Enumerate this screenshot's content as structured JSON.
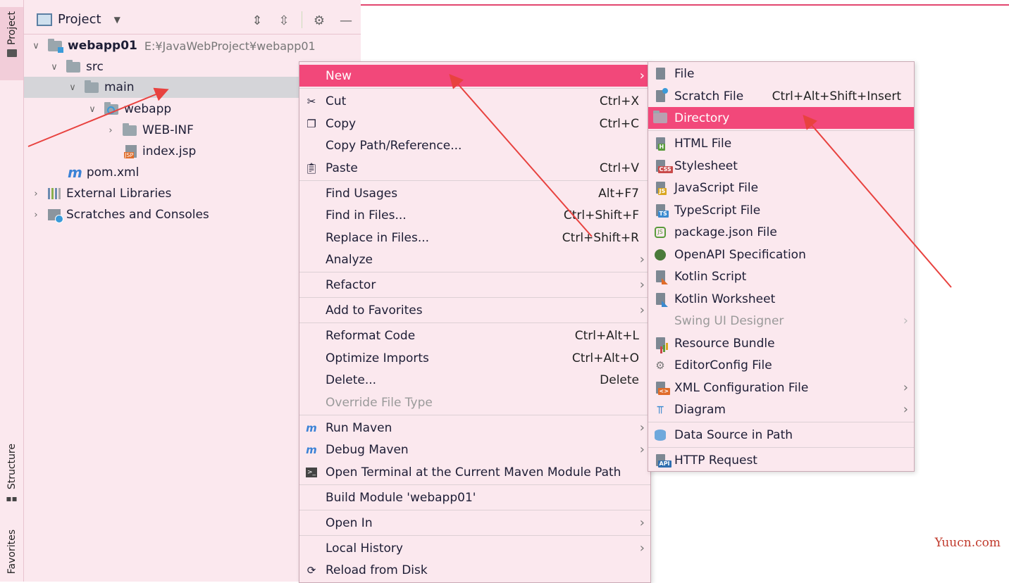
{
  "tool_strip": {
    "project_tab": "Project",
    "structure_tab": "Structure",
    "favorites_tab": "Favorites"
  },
  "panel": {
    "title": "Project",
    "tree": [
      {
        "label": "webapp01",
        "path": "E:¥JavaWebProject¥webapp01",
        "icon": "module-icon"
      },
      {
        "label": "src",
        "icon": "folder-icon"
      },
      {
        "label": "main",
        "icon": "folder-icon",
        "selected": true
      },
      {
        "label": "webapp",
        "icon": "web-folder-icon"
      },
      {
        "label": "WEB-INF",
        "icon": "folder-icon"
      },
      {
        "label": "index.jsp",
        "icon": "jsp-file-icon",
        "badge": "JSP"
      },
      {
        "label": "pom.xml",
        "icon": "maven-icon",
        "glyph": "m"
      },
      {
        "label": "External Libraries",
        "icon": "libraries-icon"
      },
      {
        "label": "Scratches and Consoles",
        "icon": "scratches-icon"
      }
    ]
  },
  "context_menu": {
    "items": [
      {
        "label": "New",
        "shortcut": "",
        "highlighted": true,
        "submenu": true
      },
      {
        "label": "Cut",
        "shortcut": "Ctrl+X",
        "icon": "scissors-icon"
      },
      {
        "label": "Copy",
        "shortcut": "Ctrl+C",
        "icon": "copy-icon"
      },
      {
        "label": "Copy Path/Reference...",
        "shortcut": ""
      },
      {
        "label": "Paste",
        "shortcut": "Ctrl+V",
        "icon": "paste-icon"
      },
      {
        "label": "Find Usages",
        "shortcut": "Alt+F7"
      },
      {
        "label": "Find in Files...",
        "shortcut": "Ctrl+Shift+F"
      },
      {
        "label": "Replace in Files...",
        "shortcut": "Ctrl+Shift+R"
      },
      {
        "label": "Analyze",
        "shortcut": "",
        "submenu": true
      },
      {
        "label": "Refactor",
        "shortcut": "",
        "submenu": true
      },
      {
        "label": "Add to Favorites",
        "shortcut": "",
        "submenu": true
      },
      {
        "label": "Reformat Code",
        "shortcut": "Ctrl+Alt+L"
      },
      {
        "label": "Optimize Imports",
        "shortcut": "Ctrl+Alt+O"
      },
      {
        "label": "Delete...",
        "shortcut": "Delete"
      },
      {
        "label": "Override File Type",
        "shortcut": "",
        "disabled": true
      },
      {
        "label": "Run Maven",
        "shortcut": "",
        "submenu": true,
        "icon": "maven-run-icon"
      },
      {
        "label": "Debug Maven",
        "shortcut": "",
        "submenu": true,
        "icon": "maven-debug-icon"
      },
      {
        "label": "Open Terminal at the Current Maven Module Path",
        "shortcut": "",
        "icon": "terminal-icon"
      },
      {
        "label": "Build Module 'webapp01'",
        "shortcut": ""
      },
      {
        "label": "Open In",
        "shortcut": "",
        "submenu": true
      },
      {
        "label": "Local History",
        "shortcut": "",
        "submenu": true
      },
      {
        "label": "Reload from Disk",
        "shortcut": "",
        "icon": "reload-icon"
      }
    ]
  },
  "new_submenu": {
    "items": [
      {
        "label": "File",
        "shortcut": ""
      },
      {
        "label": "Scratch File",
        "shortcut": "Ctrl+Alt+Shift+Insert"
      },
      {
        "label": "Directory",
        "shortcut": "",
        "highlighted": true
      },
      {
        "label": "HTML File",
        "badge": "H"
      },
      {
        "label": "Stylesheet",
        "badge": "CSS"
      },
      {
        "label": "JavaScript File",
        "badge": "JS"
      },
      {
        "label": "TypeScript File",
        "badge": "TS"
      },
      {
        "label": "package.json File",
        "badge": "JS"
      },
      {
        "label": "OpenAPI Specification"
      },
      {
        "label": "Kotlin Script"
      },
      {
        "label": "Kotlin Worksheet"
      },
      {
        "label": "Swing UI Designer",
        "disabled": true,
        "submenu": true
      },
      {
        "label": "Resource Bundle"
      },
      {
        "label": "EditorConfig File"
      },
      {
        "label": "XML Configuration File",
        "submenu": true,
        "badge": "<>"
      },
      {
        "label": "Diagram",
        "submenu": true
      },
      {
        "label": "Data Source in Path"
      },
      {
        "label": "HTTP Request",
        "badge": "API"
      }
    ]
  },
  "watermark": "Yuucn.com",
  "colors": {
    "highlight": "#f2487a",
    "panel_bg": "#fbe8ee",
    "arrow": "#e8423f"
  }
}
